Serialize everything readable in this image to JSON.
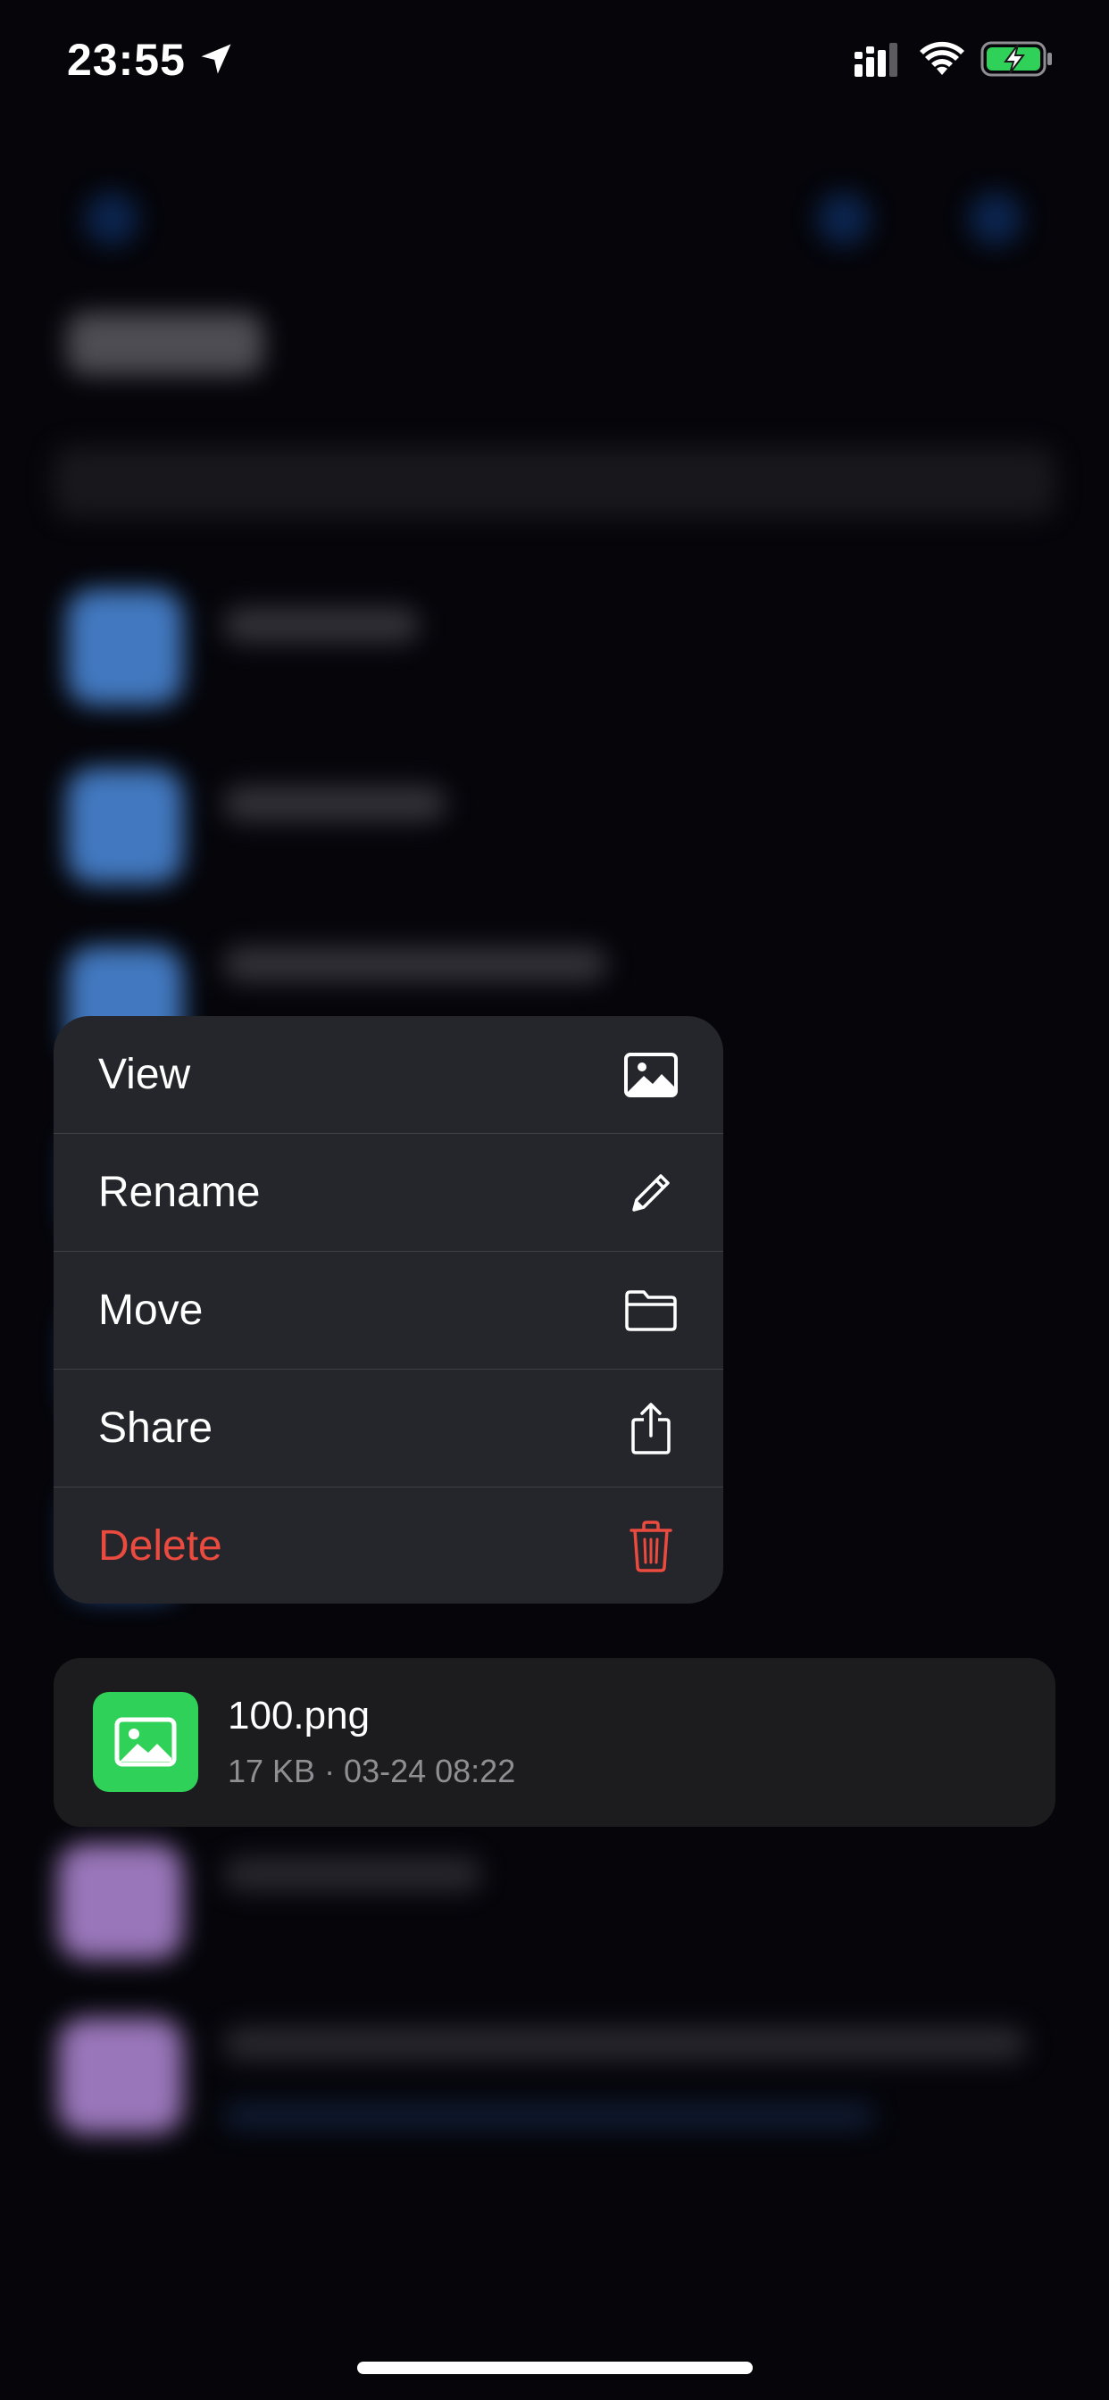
{
  "status_bar": {
    "time": "23:55",
    "icons": [
      "location-arrow-icon",
      "cellular-signal-icon",
      "wifi-icon",
      "battery-charging-icon"
    ],
    "battery_color": "#30d158"
  },
  "context_menu": {
    "items": [
      {
        "label": "View",
        "icon": "photo-icon",
        "destructive": false
      },
      {
        "label": "Rename",
        "icon": "pencil-icon",
        "destructive": false
      },
      {
        "label": "Move",
        "icon": "folder-icon",
        "destructive": false
      },
      {
        "label": "Share",
        "icon": "share-icon",
        "destructive": false
      },
      {
        "label": "Delete",
        "icon": "trash-icon",
        "destructive": true
      }
    ],
    "destructive_color": "#eb4b3f"
  },
  "selected_file": {
    "name": "100.png",
    "meta": "17 KB · 03-24 08:22",
    "thumbnail_icon": "image-icon",
    "thumbnail_color": "#30d158"
  }
}
